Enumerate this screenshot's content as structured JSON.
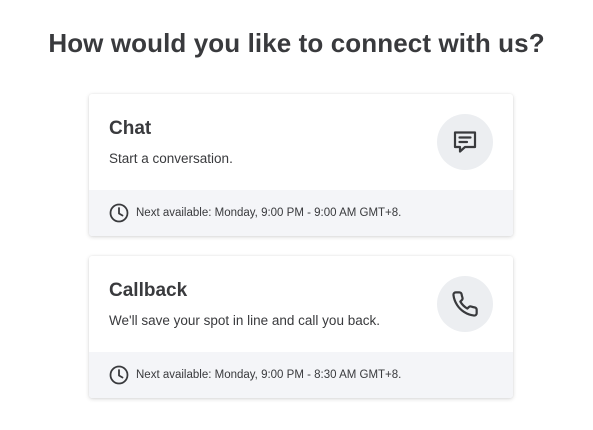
{
  "heading": "How would you like to connect with us?",
  "options": [
    {
      "title": "Chat",
      "description": "Start a conversation.",
      "icon": "chat-bubble-icon",
      "availability": "Next available: Monday, 9:00 PM - 9:00 AM GMT+8."
    },
    {
      "title": "Callback",
      "description": "We'll save your spot in line and call you back.",
      "icon": "phone-icon",
      "availability": "Next available: Monday, 9:00 PM - 8:30 AM GMT+8."
    }
  ],
  "colors": {
    "text": "#393a3d",
    "icon_bg": "#eceef1",
    "footer_bg": "#f4f5f8"
  }
}
